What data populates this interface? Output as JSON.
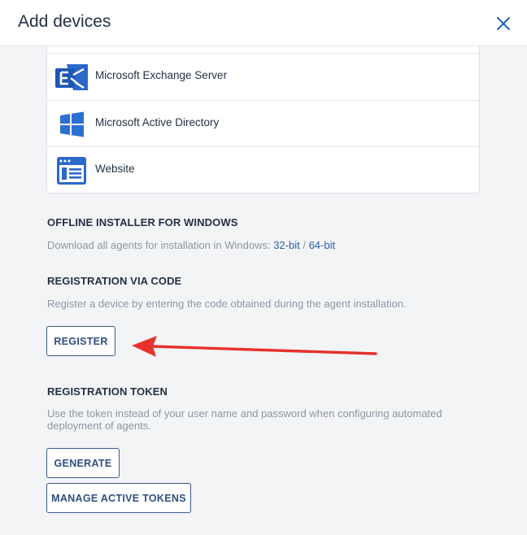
{
  "header": {
    "title": "Add devices"
  },
  "devices": [
    {
      "label": "Microsoft Exchange Server",
      "icon": "exchange-icon"
    },
    {
      "label": "Microsoft Active Directory",
      "icon": "windows-icon"
    },
    {
      "label": "Website",
      "icon": "website-icon"
    }
  ],
  "offline": {
    "title": "OFFLINE INSTALLER FOR WINDOWS",
    "desc": "Download all agents for installation in Windows: ",
    "link32": "32-bit",
    "sep": " / ",
    "link64": "64-bit"
  },
  "reg_code": {
    "title": "REGISTRATION VIA CODE",
    "desc": "Register a device by entering the code obtained during the agent installation.",
    "button": "REGISTER"
  },
  "reg_token": {
    "title": "REGISTRATION TOKEN",
    "desc": "Use the token instead of your user name and password when configuring automated deployment of agents.",
    "generate_button": "GENERATE",
    "manage_button": "MANAGE ACTIVE TOKENS"
  },
  "colors": {
    "accent": "#1f62b8",
    "button_border": "#3a5a8c",
    "arrow": "#e5322d"
  }
}
